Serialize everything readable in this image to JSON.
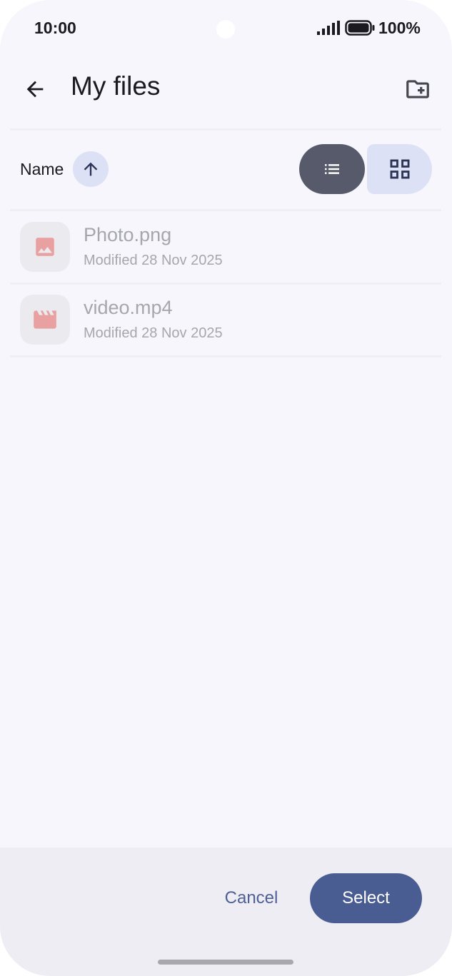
{
  "status_bar": {
    "time": "10:00",
    "battery": "100%",
    "signal_icon": "signal-bars-icon",
    "battery_icon": "battery-full-icon"
  },
  "app_bar": {
    "title": "My files",
    "back_icon": "arrow-back-icon",
    "new_folder_icon": "create-new-folder-icon"
  },
  "sort": {
    "label": "Name",
    "direction_icon": "arrow-up-icon"
  },
  "view_toggle": {
    "selected": "list",
    "list_icon": "list-view-icon",
    "grid_icon": "grid-view-icon"
  },
  "files": [
    {
      "name": "Photo.png",
      "meta": "Modified 28 Nov 2025",
      "icon": "image-icon"
    },
    {
      "name": "video.mp4",
      "meta": "Modified 28 Nov 2025",
      "icon": "movie-clapper-icon"
    }
  ],
  "actions": {
    "cancel_label": "Cancel",
    "select_label": "Select"
  },
  "colors": {
    "background": "#f7f6fc",
    "primary": "#4a5d93",
    "file_icon": "#e8a0a0",
    "muted_text": "#a6a6ad"
  }
}
